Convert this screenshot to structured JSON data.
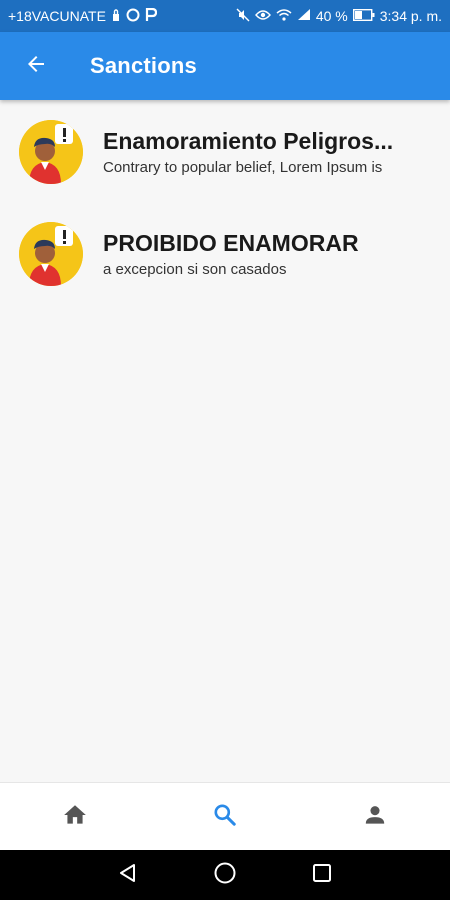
{
  "status_bar": {
    "left_text": "+18VACUNATE",
    "battery": "40 %",
    "time": "3:34 p. m.",
    "icons": [
      "lock-icon",
      "opera-icon",
      "p-icon",
      "mute-icon",
      "eye-icon",
      "wifi-icon",
      "signal-icon",
      "battery-icon"
    ]
  },
  "app_bar": {
    "title": "Sanctions",
    "back_icon": "arrow-back-icon",
    "color": "#2a8ae8"
  },
  "sanctions": [
    {
      "title": "Enamoramiento Peligros...",
      "subtitle": "Contrary to popular belief, Lorem Ipsum is",
      "avatar_icon": "person-alert-avatar"
    },
    {
      "title": "PROIBIDO ENAMORAR",
      "subtitle": "a excepcion si son casados",
      "avatar_icon": "person-alert-avatar"
    }
  ],
  "bottom_nav": {
    "items": [
      {
        "icon": "home-icon",
        "active": false
      },
      {
        "icon": "search-icon",
        "active": true
      },
      {
        "icon": "person-icon",
        "active": false
      }
    ],
    "active_color": "#2a8ae8",
    "inactive_color": "#555555"
  },
  "system_nav": {
    "icons": [
      "back-triangle-icon",
      "home-circle-icon",
      "recents-square-icon"
    ]
  }
}
